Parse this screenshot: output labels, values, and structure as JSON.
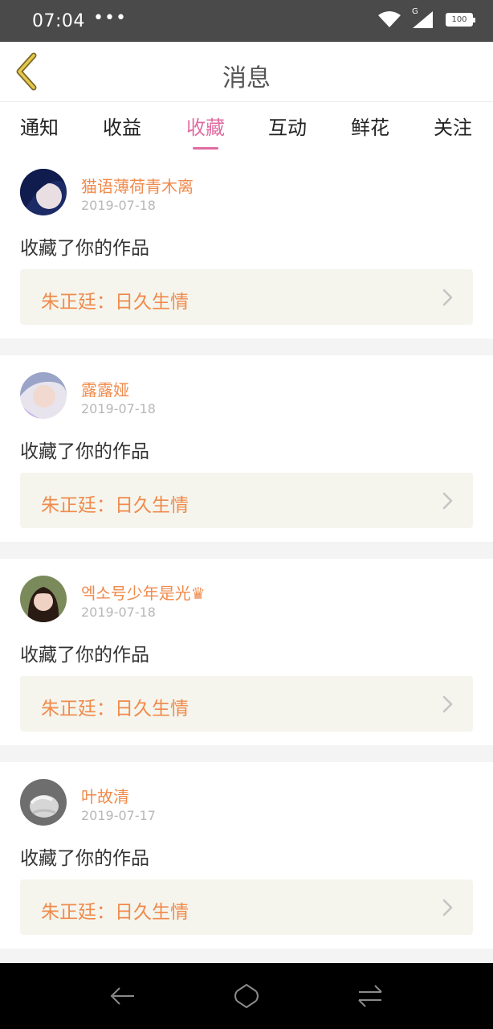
{
  "status_bar": {
    "time": "07:04",
    "dots": "•••",
    "network_label": "G",
    "battery": "100"
  },
  "header": {
    "title": "消息",
    "back_icon": "chevron-left-icon"
  },
  "tabs": [
    {
      "label": "通知",
      "active": false
    },
    {
      "label": "收益",
      "active": false
    },
    {
      "label": "收藏",
      "active": true
    },
    {
      "label": "互动",
      "active": false
    },
    {
      "label": "鲜花",
      "active": false
    },
    {
      "label": "关注",
      "active": false
    }
  ],
  "colors": {
    "accent_pink": "#e06ca2",
    "name_orange": "#f08a4b",
    "work_bg": "#f5f5ed"
  },
  "messages": [
    {
      "name": "猫语薄荷青木离",
      "date": "2019-07-18",
      "action": "收藏了你的作品",
      "work": "朱正廷：日久生情"
    },
    {
      "name": "露露娅",
      "date": "2019-07-18",
      "action": "收藏了你的作品",
      "work": "朱正廷：日久生情"
    },
    {
      "name": "엑소号少年是光♛",
      "date": "2019-07-18",
      "action": "收藏了你的作品",
      "work": "朱正廷：日久生情"
    },
    {
      "name": "叶故清",
      "date": "2019-07-17",
      "action": "收藏了你的作品",
      "work": "朱正廷：日久生情"
    }
  ],
  "nav_bar": {
    "back_icon": "nav-back-icon",
    "home_icon": "nav-home-icon",
    "switch_icon": "nav-recent-icon"
  }
}
